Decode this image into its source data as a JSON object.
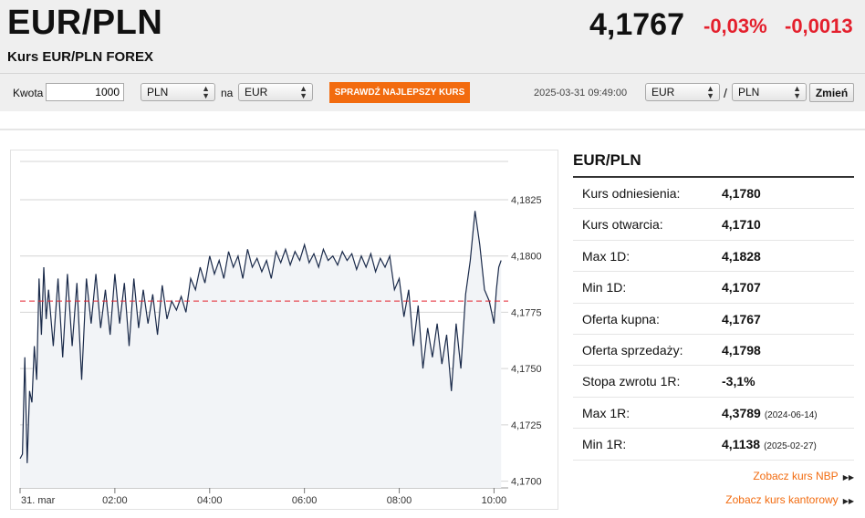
{
  "header": {
    "pair": "EUR/PLN",
    "subtitle": "Kurs EUR/PLN FOREX",
    "rate": "4,1767",
    "change_pct": "-0,03%",
    "change_abs": "-0,0013"
  },
  "converter": {
    "amount_label": "Kwota",
    "amount_value": "1000",
    "from_currency": "PLN",
    "na_label": "na",
    "to_currency": "EUR",
    "check_button": "SPRAWDŹ NAJLEPSZY KURS",
    "timestamp": "2025-03-31 09:49:00",
    "pair_base": "EUR",
    "slash": "/",
    "pair_quote": "PLN",
    "change_button": "Zmień"
  },
  "colors": {
    "accent": "#f26b0f",
    "negative": "#e4202d",
    "line": "#1a2a4a",
    "reference": "#e4202d"
  },
  "panel": {
    "title": "EUR/PLN",
    "rows": [
      {
        "label": "Kurs odniesienia:",
        "value": "4,1780",
        "date": ""
      },
      {
        "label": "Kurs otwarcia:",
        "value": "4,1710",
        "date": ""
      },
      {
        "label": "Max 1D:",
        "value": "4,1828",
        "date": ""
      },
      {
        "label": "Min 1D:",
        "value": "4,1707",
        "date": ""
      },
      {
        "label": "Oferta kupna:",
        "value": "4,1767",
        "date": ""
      },
      {
        "label": "Oferta sprzedaży:",
        "value": "4,1798",
        "date": ""
      },
      {
        "label": "Stopa zwrotu 1R:",
        "value": "-3,1%",
        "date": ""
      },
      {
        "label": "Max 1R:",
        "value": "4,3789",
        "date": "(2024-06-14)"
      },
      {
        "label": "Min 1R:",
        "value": "4,1138",
        "date": "(2025-02-27)"
      }
    ],
    "link_nbp": "Zobacz kurs NBP",
    "link_kantor": "Zobacz kurs kantorowy"
  },
  "chart_data": {
    "type": "line",
    "title": "",
    "xlabel": "",
    "ylabel": "",
    "ylim": [
      4.1697,
      4.1842
    ],
    "xlim_hours": [
      0.0,
      10.3
    ],
    "y_ticks": [
      4.1825,
      4.18,
      4.1775,
      4.175,
      4.1725,
      4.17
    ],
    "y_tick_labels": [
      "4,1825",
      "4,1800",
      "4,1775",
      "4,1750",
      "4,1725",
      "4,1700"
    ],
    "x_ticks": [
      0,
      2,
      4,
      6,
      8,
      10
    ],
    "x_tick_labels": [
      "31. mar",
      "02:00",
      "04:00",
      "06:00",
      "08:00",
      "10:00"
    ],
    "grid": true,
    "reference_line": 4.178,
    "series": [
      {
        "x": [
          0.0,
          0.05,
          0.1,
          0.15,
          0.2,
          0.25,
          0.3,
          0.35,
          0.4,
          0.45,
          0.5,
          0.55,
          0.6,
          0.7,
          0.8,
          0.9,
          1.0,
          1.1,
          1.2,
          1.3,
          1.4,
          1.5,
          1.6,
          1.7,
          1.8,
          1.9,
          2.0,
          2.1,
          2.2,
          2.3,
          2.4,
          2.5,
          2.6,
          2.7,
          2.8,
          2.9,
          3.0,
          3.1,
          3.2,
          3.3,
          3.4,
          3.5,
          3.6,
          3.7,
          3.8,
          3.9,
          4.0,
          4.1,
          4.2,
          4.3,
          4.4,
          4.5,
          4.6,
          4.7,
          4.8,
          4.9,
          5.0,
          5.1,
          5.2,
          5.3,
          5.4,
          5.5,
          5.6,
          5.7,
          5.8,
          5.9,
          6.0,
          6.1,
          6.2,
          6.3,
          6.4,
          6.5,
          6.6,
          6.7,
          6.8,
          6.9,
          7.0,
          7.1,
          7.2,
          7.3,
          7.4,
          7.5,
          7.6,
          7.7,
          7.8,
          7.9,
          8.0,
          8.1,
          8.2,
          8.3,
          8.4,
          8.5,
          8.6,
          8.7,
          8.8,
          8.9,
          9.0,
          9.1,
          9.2,
          9.3,
          9.4,
          9.5,
          9.6,
          9.7,
          9.8,
          9.9,
          10.0,
          10.05,
          10.1,
          10.15
        ],
        "y": [
          4.171,
          4.1712,
          4.1755,
          4.1708,
          4.174,
          4.1735,
          4.176,
          4.1745,
          4.179,
          4.1765,
          4.1795,
          4.1772,
          4.1785,
          4.176,
          4.179,
          4.1755,
          4.1792,
          4.176,
          4.1788,
          4.1745,
          4.179,
          4.177,
          4.1792,
          4.1768,
          4.1785,
          4.1765,
          4.1792,
          4.177,
          4.1788,
          4.176,
          4.179,
          4.1768,
          4.1785,
          4.177,
          4.1783,
          4.1765,
          4.1787,
          4.1772,
          4.178,
          4.1776,
          4.1782,
          4.1775,
          4.179,
          4.1785,
          4.1795,
          4.1788,
          4.18,
          4.1792,
          4.1798,
          4.179,
          4.1802,
          4.1795,
          4.18,
          4.179,
          4.1803,
          4.1795,
          4.1799,
          4.1793,
          4.1798,
          4.179,
          4.1802,
          4.1797,
          4.1803,
          4.1796,
          4.1802,
          4.1798,
          4.1805,
          4.1797,
          4.1801,
          4.1795,
          4.1803,
          4.1798,
          4.18,
          4.1796,
          4.1802,
          4.1798,
          4.1801,
          4.1794,
          4.18,
          4.1795,
          4.1801,
          4.1793,
          4.1799,
          4.1795,
          4.18,
          4.1785,
          4.179,
          4.1773,
          4.1785,
          4.176,
          4.1778,
          4.175,
          4.1768,
          4.1755,
          4.177,
          4.1752,
          4.1765,
          4.174,
          4.177,
          4.175,
          4.1783,
          4.1798,
          4.182,
          4.1805,
          4.1785,
          4.178,
          4.177,
          4.1785,
          4.1795,
          4.1798
        ]
      }
    ]
  }
}
